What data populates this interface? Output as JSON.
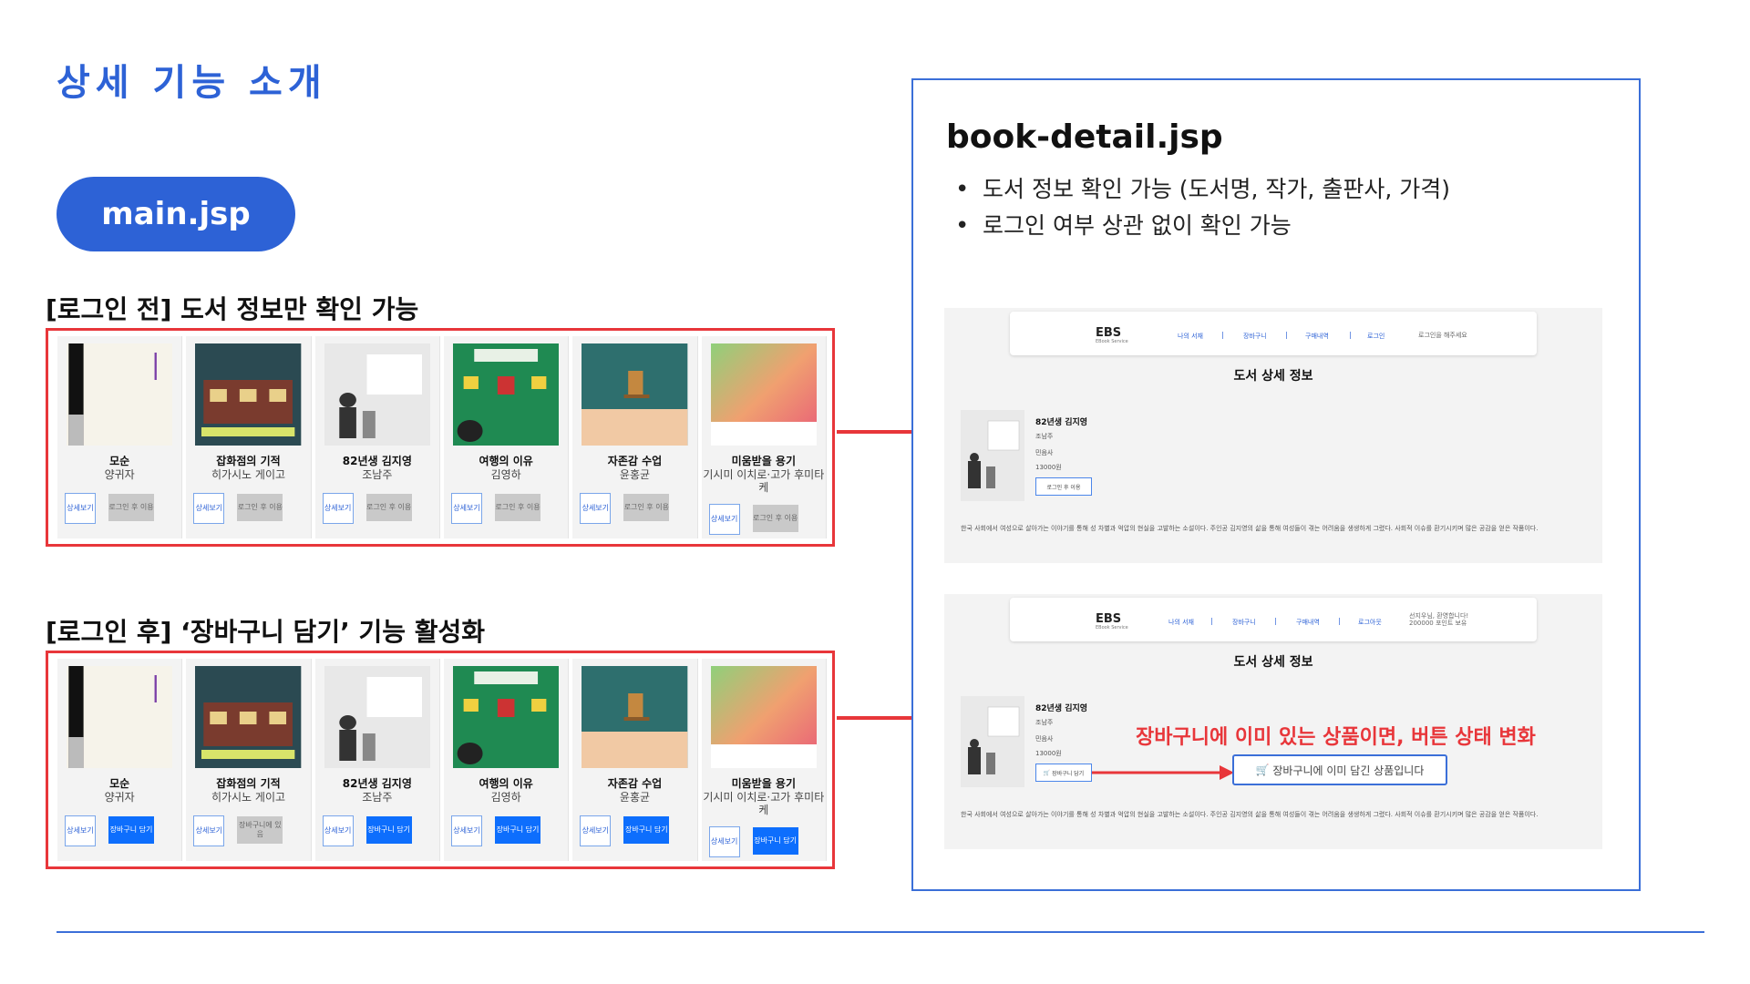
{
  "page_title": "상세 기능 소개",
  "pill_label": "main.jsp",
  "before_login_label": "[로그인 전] 도서 정보만 확인 가능",
  "after_login_label": "[로그인 후] ‘장바구니 담기’ 기능 활성화",
  "books": [
    {
      "title": "모순",
      "author": "양귀자"
    },
    {
      "title": "잡화점의 기적",
      "author": "히가시노 게이고"
    },
    {
      "title": "82년생 김지영",
      "author": "조남주"
    },
    {
      "title": "여행의 이유",
      "author": "김영하"
    },
    {
      "title": "자존감 수업",
      "author": "윤홍균"
    },
    {
      "title": "미움받을 용기",
      "author": "기시미 이치로·고가 후미타케"
    }
  ],
  "buttons": {
    "detail": "상세보기",
    "login_required": "로그인 후 이용",
    "add_cart": "장바구니 담기",
    "in_cart": "장바구니에 있음"
  },
  "detail": {
    "file_title": "book-detail.jsp",
    "bullets": [
      "도서 정보 확인 가능 (도서명, 작가, 출판사, 가격)",
      "로그인 여부 상관 없이 확인 가능"
    ],
    "nav": {
      "logo": "EBS",
      "logo_sub": "EBook Service",
      "my_library": "나의 서재",
      "cart": "장바구니",
      "orders": "구매내역",
      "login": "로그인",
      "logout": "로그아웃",
      "login_prompt": "로그인을 해주세요",
      "welcome": "선지우님, 환영합니다!",
      "points": "200000 포인트 보유"
    },
    "heading": "도서 상세 정보",
    "book_title": "82년생 김지영",
    "book_author": "조남주",
    "publisher": "민음사",
    "price": "13000원",
    "btn_login_required": "로그인 후 이용",
    "btn_add_cart": "장바구니 담기",
    "btn_in_cart": "장바구니에 이미 담긴 상품입니다",
    "description": "한국 사회에서 여성으로 살아가는 이야기를 통해 성 차별과 억압의 현실을 고발하는 소설이다. 주인공 김지영의 삶을 통해 여성들이 겪는 어려움을 생생하게 그렸다. 사회적 이슈를 환기시키며 많은 공감을 얻은 작품이다.",
    "red_note": "장바구니에 이미 있는 상품이면, 버튼 상태 변화"
  },
  "colors": {
    "accent": "#2d62d6",
    "red": "#e8363a",
    "button_blue": "#0d6efd"
  }
}
